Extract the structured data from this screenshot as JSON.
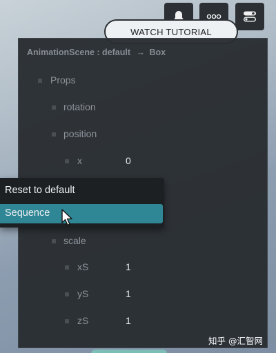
{
  "toolbar": {
    "notifications_icon": "bell-icon",
    "more_icon": "more-dots-icon",
    "panels_icon": "toggles-icon"
  },
  "watch_tutorial_label": "WATCH TUTORIAL",
  "panel": {
    "breadcrumb_scene": "AnimationScene : default",
    "breadcrumb_arrow": "→",
    "breadcrumb_object": "Box",
    "props_label": "Props",
    "rotation_label": "rotation",
    "position_label": "position",
    "x_label": "x",
    "x_value": "0",
    "scale_label": "scale",
    "xS_label": "xS",
    "xS_value": "1",
    "yS_label": "yS",
    "yS_value": "1",
    "zS_label": "zS",
    "zS_value": "1"
  },
  "context_menu": {
    "reset_label": "Reset to default",
    "sequence_label": "Sequence"
  },
  "watermark": "知乎 @汇智网",
  "colors": {
    "panel_bg": "#292d31",
    "menu_bg": "#1d2023",
    "menu_highlight": "#2f8796",
    "label_text": "#8c939a",
    "value_text": "#e9eaec"
  }
}
